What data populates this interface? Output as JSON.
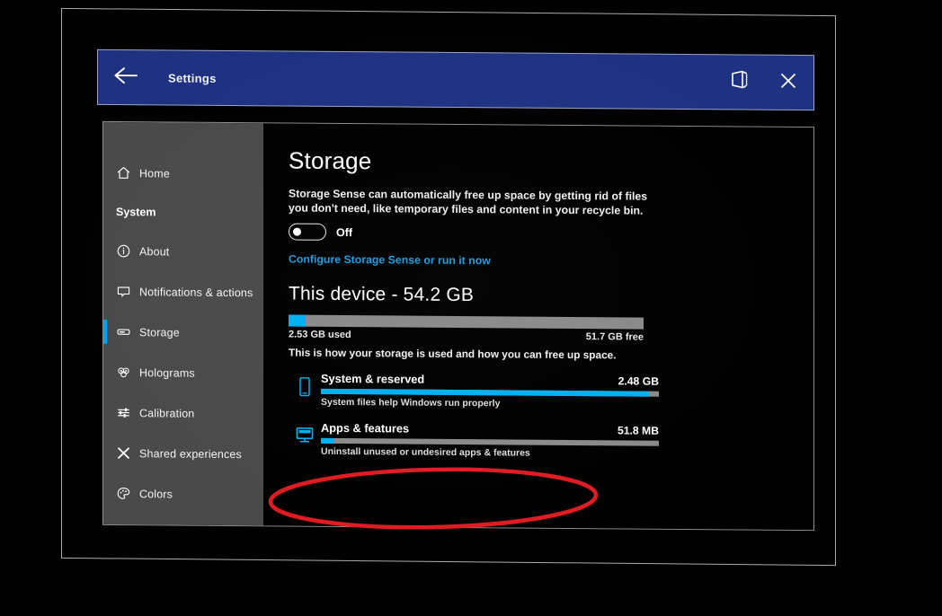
{
  "window": {
    "title": "Settings",
    "back_icon": "back-arrow-icon",
    "hologram_icon": "hologram-window-icon",
    "close_icon": "close-icon",
    "titlebar_color": "#1f3282"
  },
  "sidebar": {
    "accent_color": "#00a2e8",
    "background_color": "#4a4a4a",
    "home": {
      "label": "Home",
      "icon": "home-icon"
    },
    "group_label": "System",
    "items": [
      {
        "label": "About",
        "icon": "info-icon",
        "selected": false
      },
      {
        "label": "Notifications & actions",
        "icon": "notification-icon",
        "selected": false
      },
      {
        "label": "Storage",
        "icon": "storage-icon",
        "selected": true
      },
      {
        "label": "Holograms",
        "icon": "holograms-icon",
        "selected": false
      },
      {
        "label": "Calibration",
        "icon": "sliders-icon",
        "selected": false
      },
      {
        "label": "Shared experiences",
        "icon": "shared-experiences-icon",
        "selected": false
      },
      {
        "label": "Colors",
        "icon": "palette-icon",
        "selected": false
      }
    ]
  },
  "main": {
    "heading": "Storage",
    "description": "Storage Sense can automatically free up space by getting rid of files you don't need, like temporary files and content in your recycle bin.",
    "storage_sense_toggle": {
      "state": "Off",
      "on": false
    },
    "configure_link": "Configure Storage Sense or run it now",
    "device": {
      "heading": "This device - 54.2 GB",
      "used_label": "2.53 GB used",
      "free_label": "51.7 GB free",
      "used_percent": 4.7,
      "bar_used_color": "#00b0f0",
      "bar_track_color": "#8a8a8a"
    },
    "hint": "This is how your storage is used and how you can free up space.",
    "items": [
      {
        "name": "System & reserved",
        "size": "2.48 GB",
        "subtitle": "System files help Windows run properly",
        "fill_percent": 97,
        "icon": "device-phone-icon"
      },
      {
        "name": "Apps & features",
        "size": "51.8 MB",
        "subtitle": "Uninstall unused or undesired apps & features",
        "fill_percent": 4,
        "icon": "monitor-apps-icon"
      }
    ]
  },
  "annotation": {
    "shape": "ellipse",
    "color": "#e01b22",
    "target": "Apps & features"
  }
}
